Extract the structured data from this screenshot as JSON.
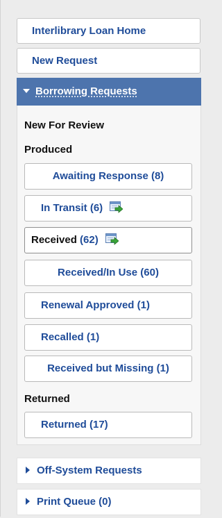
{
  "nav": {
    "home": "Interlibrary Loan Home",
    "new_request": "New Request"
  },
  "borrowing": {
    "header": "Borrowing Requests",
    "new_for_review": "New For Review",
    "produced_heading": "Produced",
    "items": {
      "awaiting_response": "Awaiting Response (8)",
      "in_transit": "In Transit (6)",
      "received_word": "Received",
      "received_count": "(62)",
      "received_in_use": "Received/In Use (60)",
      "renewal_approved": "Renewal Approved (1)",
      "recalled": "Recalled (1)",
      "received_missing": "Received but Missing (1)"
    },
    "returned_heading": "Returned",
    "returned": "Returned (17)"
  },
  "sections": {
    "off_system": "Off-System Requests",
    "print_queue": "Print Queue (0)"
  },
  "icons": {
    "transfer": "transfer-arrow-icon",
    "expanded": "triangle-down-icon",
    "collapsed": "triangle-right-icon"
  },
  "colors": {
    "link": "#1f4c99",
    "header_bg": "#4d74ad",
    "panel_bg": "#f7f7f7",
    "icon_green": "#3aa53a"
  }
}
